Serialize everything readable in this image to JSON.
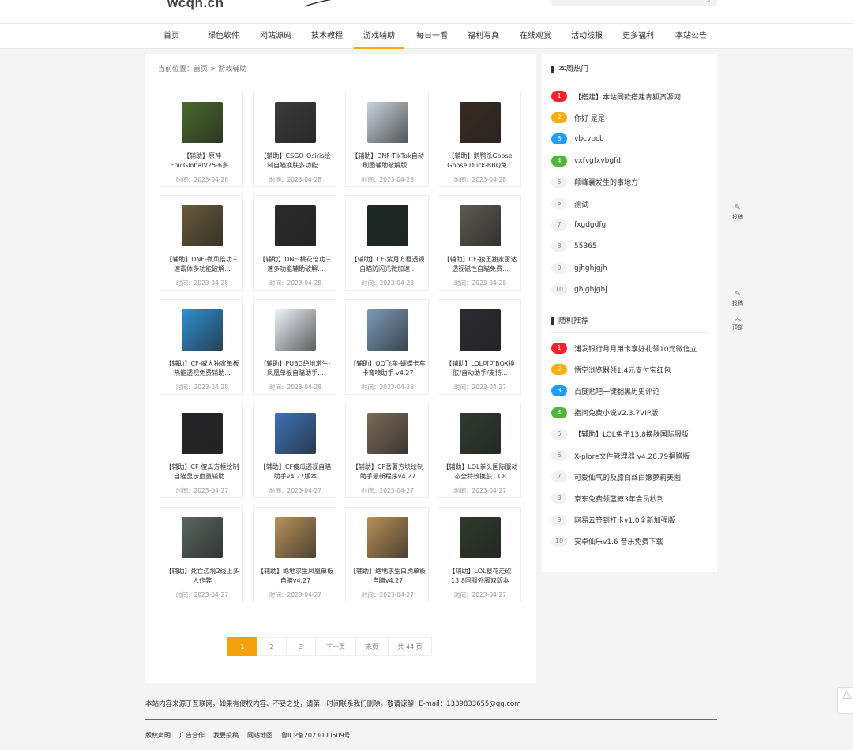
{
  "header": {
    "logo": "wcqh.cn",
    "search_icon": "search-icon"
  },
  "nav": [
    {
      "label": "首页"
    },
    {
      "label": "绿色软件"
    },
    {
      "label": "网站源码"
    },
    {
      "label": "技术教程"
    },
    {
      "label": "游戏辅助"
    },
    {
      "label": "每日一看"
    },
    {
      "label": "福利写真"
    },
    {
      "label": "在线观赏"
    },
    {
      "label": "活动线报"
    },
    {
      "label": "更多福利"
    },
    {
      "label": "本站公告"
    }
  ],
  "nav_active": "游戏辅助",
  "breadcrumb": "当前位置：首页 > 游戏辅助",
  "date_prefix": "时间：",
  "posts": [
    {
      "title": "【辅助】原神EpicGlobalV25-6多...",
      "date": "时间：2023-04-28",
      "color": "#4a6a2c"
    },
    {
      "title": "【辅助】CSGO-Osiris绘制自瞄换肤多功能...",
      "date": "时间：2023-04-28",
      "color": "#3b3b3b"
    },
    {
      "title": "【辅助】DNF-TikTok自动刷图辅助破解版...",
      "date": "时间：2023-04-28",
      "color": "#c9d3dc"
    },
    {
      "title": "【辅助】鹅鸭杀Goose Goose Duck-BBQ免...",
      "date": "时间：2023-04-28",
      "color": "#3a2a22"
    },
    {
      "title": "【辅助】DNF-微风倍功三速霸体多功能破解...",
      "date": "时间：2023-04-28",
      "color": "#6a5a3a"
    },
    {
      "title": "【辅助】DNF-桃花倍功三速多功能辅助破解...",
      "date": "时间：2023-04-28",
      "color": "#2a2a2a"
    },
    {
      "title": "【辅助】CF-紫月方框透视自瞄防闪光微加速...",
      "date": "时间：2023-04-28",
      "color": "#1d2a26"
    },
    {
      "title": "【辅助】CF-狼王独家雷达透视磁性自瞄免费...",
      "date": "时间：2023-04-28",
      "color": "#5b5a52"
    },
    {
      "title": "【辅助】CF-威大独家单板热能透视免费辅助...",
      "date": "时间：2023-04-28",
      "color": "#2f8fd4"
    },
    {
      "title": "【辅助】PUBG绝地求生-凤凰单板自瞄助手...",
      "date": "时间：2023-04-28",
      "color": "#eef3f8"
    },
    {
      "title": "【辅助】QQ飞车-蝴蝶卡车卡弯喷助手 v4.27",
      "date": "时间：2023-04-28",
      "color": "#7a9ab8"
    },
    {
      "title": "【辅助】LOL可可BOX换肤/自动助手/支持...",
      "date": "时间：2023-04-27",
      "color": "#2b2a30"
    },
    {
      "title": "【辅助】CF-傻瓜方框绘制自瞄显示血量辅助...",
      "date": "时间：2023-04-27",
      "color": "#252527"
    },
    {
      "title": "【辅助】CF傻瓜透视自瞄助手v4.27版本",
      "date": "时间：2023-04-27",
      "color": "#3c72b8"
    },
    {
      "title": "【辅助】CF番薯方块绘制助手最新程序v4.27",
      "date": "时间：2023-04-27",
      "color": "#7a6a58"
    },
    {
      "title": "【辅助】LOL拳头国际服动态全特效换肤13.8",
      "date": "时间：2023-04-27",
      "color": "#2f3a30"
    },
    {
      "title": "【辅助】死亡边境2线上多人作弊",
      "date": "时间：2023-04-27",
      "color": "#5a6660"
    },
    {
      "title": "【辅助】绝地求生凤凰单板自瞄v4.27",
      "date": "时间：2023-04-27",
      "color": "#b8925a"
    },
    {
      "title": "【辅助】绝地求生白虎单板自瞄v4.27",
      "date": "时间：2023-04-27",
      "color": "#b58f58"
    },
    {
      "title": "【辅助】LOL樱花走砍13.8国服外服双版本",
      "date": "时间：2023-04-27",
      "color": "#2d3a2a"
    }
  ],
  "pagination": {
    "pages": [
      "1",
      "2",
      "3"
    ],
    "next": "下一页",
    "last": "末页",
    "total": "共 44 页",
    "active_color": "#f6a00c"
  },
  "sidebar": {
    "hot_title": "本周热门",
    "hot": [
      {
        "num": "1",
        "text": "【搭建】本站同款搭建青狐资源网"
      },
      {
        "num": "2",
        "text": "你好 是是"
      },
      {
        "num": "3",
        "text": "vbcvbcb"
      },
      {
        "num": "4",
        "text": "vxfvgfxvbgfd"
      },
      {
        "num": "5",
        "text": "颠峰囊发生的事地方"
      },
      {
        "num": "6",
        "text": "测试"
      },
      {
        "num": "7",
        "text": "fxgdgdfg"
      },
      {
        "num": "8",
        "text": "55365"
      },
      {
        "num": "9",
        "text": "gjhghjgjh"
      },
      {
        "num": "10",
        "text": "ghjghjghj"
      }
    ],
    "random_title": "随机推荐",
    "random": [
      {
        "num": "1",
        "text": "浦发银行月月用卡享好礼领10元微信立"
      },
      {
        "num": "2",
        "text": "悟空浏览器领1.4元支付宝红包"
      },
      {
        "num": "3",
        "text": "百度贴吧一键翻黑历史评论"
      },
      {
        "num": "4",
        "text": "指间免费小说V2.3.7VIP版"
      },
      {
        "num": "5",
        "text": "【辅助】LOL兔子13.8换肤国际服版"
      },
      {
        "num": "6",
        "text": "X-plore文件管理器 v4.28.79捐赠版"
      },
      {
        "num": "7",
        "text": "可爱仙气的及膝白丝白嫩萝莉美图"
      },
      {
        "num": "8",
        "text": "京东免费领蓝鲸3年会员秒到"
      },
      {
        "num": "9",
        "text": "网易云签到打卡v1.0全新加强版"
      },
      {
        "num": "10",
        "text": "安卓仙乐v1.6 音乐免费下载"
      }
    ],
    "rank_colors": {
      "1": "#f5222d",
      "2": "#faad14",
      "3": "#1e9fff",
      "4": "#52b63a"
    }
  },
  "floating": {
    "submit1": "投稿",
    "submit2": "投稿",
    "top": "顶部"
  },
  "footer": {
    "notice": "本站内容来源于互联网，如果有侵权内容、不妥之处，请第一时间联系我们删除。敬请谅解! E-mail：1339833655@qq.com",
    "links": [
      "版权声明",
      "广告合作",
      "我要投稿",
      "网站地图",
      "鲁ICP备2023000509号"
    ]
  }
}
